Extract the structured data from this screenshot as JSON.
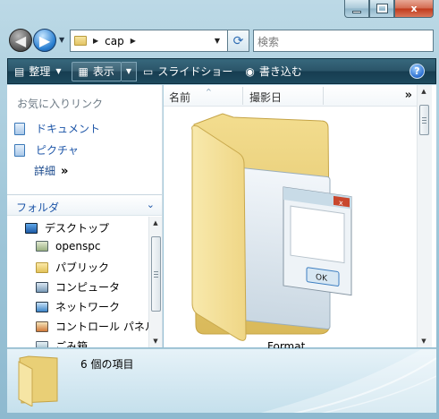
{
  "window": {
    "controls": {
      "minimize": "minimize",
      "maximize": "maximize",
      "close": "x"
    }
  },
  "address_bar": {
    "path": "cap",
    "search_placeholder": "検索"
  },
  "command_bar": {
    "organize": "整理",
    "views": "表示",
    "slideshow": "スライドショー",
    "burn": "書き込む",
    "help": "?"
  },
  "favorites": {
    "title": "お気に入りリンク",
    "items": [
      {
        "label": "ドキュメント",
        "icon": "documents-icon"
      },
      {
        "label": "ピクチャ",
        "icon": "pictures-icon"
      }
    ],
    "more": "詳細",
    "more_glyph": "»"
  },
  "folders": {
    "header": "フォルダ",
    "items": [
      {
        "label": "デスクトップ",
        "icon": "desktop-icon"
      },
      {
        "label": "openspc",
        "icon": "user-folder-icon"
      },
      {
        "label": "パブリック",
        "icon": "folder-icon"
      },
      {
        "label": "コンピュータ",
        "icon": "computer-icon"
      },
      {
        "label": "ネットワーク",
        "icon": "network-icon"
      },
      {
        "label": "コントロール パネル",
        "icon": "control-panel-icon"
      },
      {
        "label": "ごみ箱",
        "icon": "recycle-bin-icon"
      }
    ]
  },
  "file_list": {
    "columns": [
      "名前",
      "撮影日"
    ],
    "more_columns": "»",
    "items": [
      {
        "label": "Format",
        "icon": "folder-icon"
      }
    ]
  },
  "details_pane": {
    "count": "6 個の項目"
  },
  "colors": {
    "frame": "#9cc4d7",
    "command_bar": "#1d4a5e",
    "link": "#1e56a8",
    "close_button": "#c0391b"
  }
}
